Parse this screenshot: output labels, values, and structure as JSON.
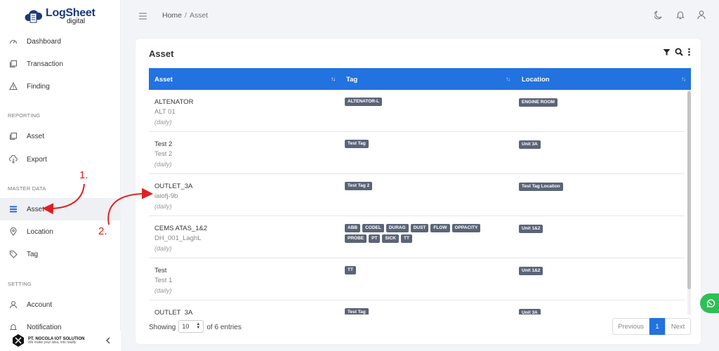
{
  "sidebar": {
    "logo": {
      "main": "LogSheet",
      "sub": "digital"
    },
    "items": [
      {
        "label": "Dashboard"
      },
      {
        "label": "Transaction"
      },
      {
        "label": "Finding"
      }
    ],
    "sections": {
      "reporting": "REPORTING",
      "master": "MASTER DATA",
      "setting": "SETTING"
    },
    "reporting_items": [
      {
        "label": "Asset"
      },
      {
        "label": "Export"
      }
    ],
    "master_items": [
      {
        "label": "Asset"
      },
      {
        "label": "Location"
      },
      {
        "label": "Tag"
      }
    ],
    "setting_items": [
      {
        "label": "Account"
      },
      {
        "label": "Notification"
      }
    ],
    "footer": {
      "company": "PT. NOCOLA IOT SOLUTION",
      "tagline": "We make your idea, into reality"
    }
  },
  "topbar": {
    "breadcrumb": {
      "home": "Home",
      "sep": "/",
      "current": "Asset"
    }
  },
  "card": {
    "title": "Asset",
    "columns": [
      "Asset",
      "Tag",
      "Location"
    ],
    "rows": [
      {
        "name": "ALTENATOR",
        "code": "ALT 01",
        "freq": "(daily)",
        "tags": [
          "ALTENATOR-L"
        ],
        "location": "ENGINE ROOM"
      },
      {
        "name": "Test 2",
        "code": "Test 2",
        "freq": "(daily)",
        "tags": [
          "Test Tag"
        ],
        "location": "Unit 3A"
      },
      {
        "name": "OUTLET_3A",
        "code": "iaiofj-9b",
        "freq": "(daily)",
        "tags": [
          "Test Tag 2"
        ],
        "location": "Test Tag Location"
      },
      {
        "name": "CEMS ATAS_1&2",
        "code": "DH_001_LaghL",
        "freq": "(daily)",
        "tags": [
          "ABB",
          "CODEL",
          "DURAG",
          "DUST",
          "FLOW",
          "OPPACITY",
          "PROBE",
          "PT",
          "SICK",
          "TT"
        ],
        "location": "Unit 1&2"
      },
      {
        "name": "Test",
        "code": "Test 1",
        "freq": "(daily)",
        "tags": [
          "TT"
        ],
        "location": "Unit 1&2"
      },
      {
        "name": "OUTLET_3A",
        "code": "",
        "freq": "",
        "tags": [
          "Test Tag"
        ],
        "location": "Unit 3A"
      }
    ],
    "footer": {
      "showing": "Showing",
      "page_size": "10",
      "of_entries": "of 6 entries",
      "prev": "Previous",
      "page": "1",
      "next": "Next"
    }
  },
  "annotations": {
    "one": "1.",
    "two": "2."
  },
  "colors": {
    "primary": "#2272e0",
    "badge": "#5b6478",
    "annotation": "#e02020",
    "whatsapp": "#2fbf55"
  }
}
